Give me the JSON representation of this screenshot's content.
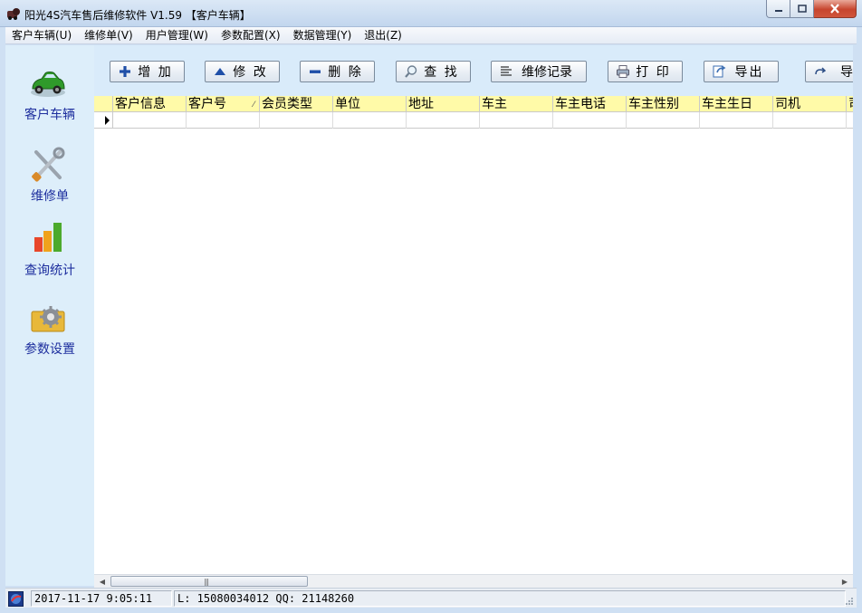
{
  "window": {
    "title": "阳光4S汽车售后维修软件 V1.59 【客户车辆】"
  },
  "menu": [
    {
      "label": "客户车辆(U)"
    },
    {
      "label": "维修单(V)"
    },
    {
      "label": "用户管理(W)"
    },
    {
      "label": "参数配置(X)"
    },
    {
      "label": "数据管理(Y)"
    },
    {
      "label": "退出(Z)"
    }
  ],
  "nav": [
    {
      "label": "客户车辆",
      "icon": "car-icon"
    },
    {
      "label": "维修单",
      "icon": "tools-icon"
    },
    {
      "label": "查询统计",
      "icon": "bar-chart-icon"
    },
    {
      "label": "参数设置",
      "icon": "settings-gear-icon"
    }
  ],
  "toolbar": {
    "add": "增 加",
    "edit": "修 改",
    "delete": "删 除",
    "find": "查 找",
    "records": "维修记录",
    "print": "打 印",
    "export": "导出",
    "more": "导"
  },
  "grid": {
    "columns": [
      "客户信息",
      "客户号",
      "会员类型",
      "单位",
      "地址",
      "车主",
      "车主电话",
      "车主性别",
      "车主生日",
      "司机",
      "司"
    ],
    "sorted_column": "客户号"
  },
  "status": {
    "datetime": "2017-11-17 9:05:11",
    "contact": "L: 15080034012 QQ: 21148260"
  },
  "colors": {
    "nav_label": "#1d2e9e",
    "grid_header_bg": "#fffaa8",
    "nav_bg": "#ddeefa"
  }
}
